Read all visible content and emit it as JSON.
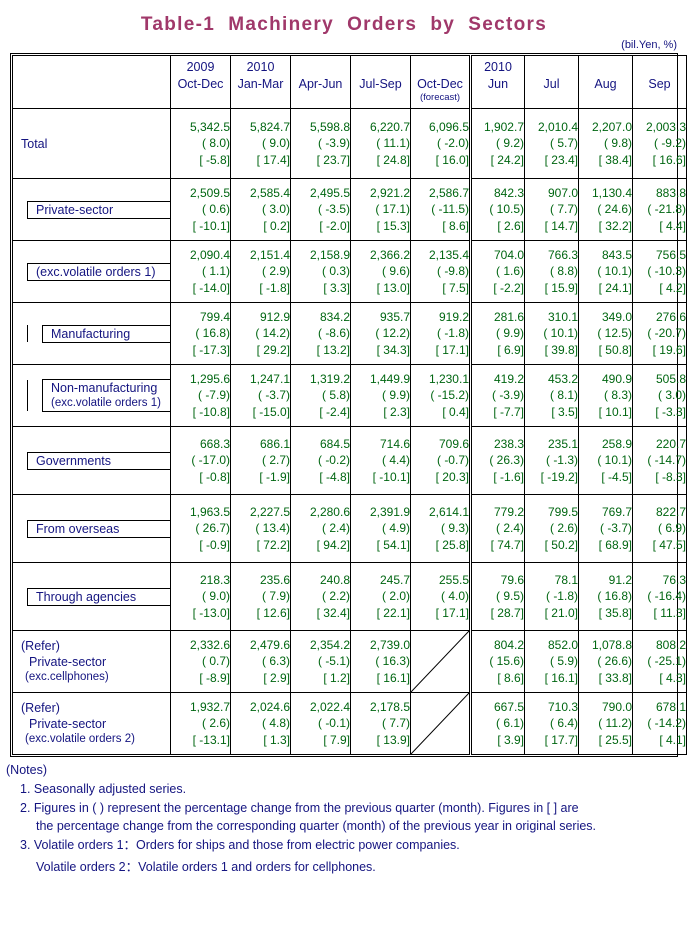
{
  "title": "Table-1  Machinery  Orders  by  Sectors",
  "unit": "(bil.Yen, %)",
  "header": {
    "blank": "",
    "columns": [
      {
        "year": "2009",
        "period": "Oct-Dec",
        "note": ""
      },
      {
        "year": "2010",
        "period": "Jan-Mar",
        "note": ""
      },
      {
        "year": "",
        "period": "Apr-Jun",
        "note": ""
      },
      {
        "year": "",
        "period": "Jul-Sep",
        "note": ""
      },
      {
        "year": "",
        "period": "Oct-Dec",
        "note": "(forecast)"
      },
      {
        "year": "2010",
        "period": "Jun",
        "note": ""
      },
      {
        "year": "",
        "period": "Jul",
        "note": ""
      },
      {
        "year": "",
        "period": "Aug",
        "note": ""
      },
      {
        "year": "",
        "period": "Sep",
        "note": ""
      }
    ]
  },
  "rows": [
    {
      "id": "total",
      "label": "Total",
      "label2": "",
      "label3": "",
      "indent": 0,
      "values": [
        {
          "v1": "5,342.5",
          "v2": "( 8.0)",
          "v3": "[ -5.8]"
        },
        {
          "v1": "5,824.7",
          "v2": "( 9.0)",
          "v3": "[ 17.4]"
        },
        {
          "v1": "5,598.8",
          "v2": "( -3.9)",
          "v3": "[ 23.7]"
        },
        {
          "v1": "6,220.7",
          "v2": "( 11.1)",
          "v3": "[ 24.8]"
        },
        {
          "v1": "6,096.5",
          "v2": "( -2.0)",
          "v3": "[ 16.0]"
        },
        {
          "v1": "1,902.7",
          "v2": "( 9.2)",
          "v3": "[ 24.2]"
        },
        {
          "v1": "2,010.4",
          "v2": "( 5.7)",
          "v3": "[ 23.4]"
        },
        {
          "v1": "2,207.0",
          "v2": "( 9.8)",
          "v3": "[ 38.4]"
        },
        {
          "v1": "2,003.3",
          "v2": "( -9.2)",
          "v3": "[ 16.6]"
        }
      ]
    },
    {
      "id": "private-sector",
      "label": "Private-sector",
      "label2": "",
      "label3": "",
      "indent": 1,
      "values": [
        {
          "v1": "2,509.5",
          "v2": "( 0.6)",
          "v3": "[ -10.1]"
        },
        {
          "v1": "2,585.4",
          "v2": "( 3.0)",
          "v3": "[ 0.2]"
        },
        {
          "v1": "2,495.5",
          "v2": "( -3.5)",
          "v3": "[ -2.0]"
        },
        {
          "v1": "2,921.2",
          "v2": "( 17.1)",
          "v3": "[ 15.3]"
        },
        {
          "v1": "2,586.7",
          "v2": "( -11.5)",
          "v3": "[ 8.6]"
        },
        {
          "v1": "842.3",
          "v2": "( 10.5)",
          "v3": "[ 2.6]"
        },
        {
          "v1": "907.0",
          "v2": "( 7.7)",
          "v3": "[ 14.7]"
        },
        {
          "v1": "1,130.4",
          "v2": "( 24.6)",
          "v3": "[ 32.2]"
        },
        {
          "v1": "883.8",
          "v2": "( -21.8)",
          "v3": "[ 4.4]"
        }
      ]
    },
    {
      "id": "private-sector-exc-volatile",
      "label": "(exc.volatile orders 1)",
      "label2": "",
      "label3": "",
      "indent": 1,
      "values": [
        {
          "v1": "2,090.4",
          "v2": "( 1.1)",
          "v3": "[ -14.0]"
        },
        {
          "v1": "2,151.4",
          "v2": "( 2.9)",
          "v3": "[ -1.8]"
        },
        {
          "v1": "2,158.9",
          "v2": "( 0.3)",
          "v3": "[ 3.3]"
        },
        {
          "v1": "2,366.2",
          "v2": "( 9.6)",
          "v3": "[ 13.0]"
        },
        {
          "v1": "2,135.4",
          "v2": "( -9.8)",
          "v3": "[ 7.5]"
        },
        {
          "v1": "704.0",
          "v2": "( 1.6)",
          "v3": "[ -2.2]"
        },
        {
          "v1": "766.3",
          "v2": "( 8.8)",
          "v3": "[ 15.9]"
        },
        {
          "v1": "843.5",
          "v2": "( 10.1)",
          "v3": "[ 24.1]"
        },
        {
          "v1": "756.5",
          "v2": "( -10.3)",
          "v3": "[ 4.2]"
        }
      ]
    },
    {
      "id": "manufacturing",
      "label": "Manufacturing",
      "label2": "",
      "label3": "",
      "indent": 2,
      "values": [
        {
          "v1": "799.4",
          "v2": "( 16.8)",
          "v3": "[ -17.3]"
        },
        {
          "v1": "912.9",
          "v2": "( 14.2)",
          "v3": "[ 29.2]"
        },
        {
          "v1": "834.2",
          "v2": "( -8.6)",
          "v3": "[ 13.2]"
        },
        {
          "v1": "935.7",
          "v2": "( 12.2)",
          "v3": "[ 34.3]"
        },
        {
          "v1": "919.2",
          "v2": "( -1.8)",
          "v3": "[ 17.1]"
        },
        {
          "v1": "281.6",
          "v2": "( 9.9)",
          "v3": "[ 6.9]"
        },
        {
          "v1": "310.1",
          "v2": "( 10.1)",
          "v3": "[ 39.8]"
        },
        {
          "v1": "349.0",
          "v2": "( 12.5)",
          "v3": "[ 50.8]"
        },
        {
          "v1": "276.6",
          "v2": "( -20.7)",
          "v3": "[ 19.6]"
        }
      ]
    },
    {
      "id": "non-manufacturing",
      "label": "Non-manufacturing",
      "label2": "(exc.volatile orders 1)",
      "label3": "",
      "indent": 2,
      "values": [
        {
          "v1": "1,295.6",
          "v2": "( -7.9)",
          "v3": "[ -10.8]"
        },
        {
          "v1": "1,247.1",
          "v2": "( -3.7)",
          "v3": "[ -15.0]"
        },
        {
          "v1": "1,319.2",
          "v2": "( 5.8)",
          "v3": "[ -2.4]"
        },
        {
          "v1": "1,449.9",
          "v2": "( 9.9)",
          "v3": "[ 2.3]"
        },
        {
          "v1": "1,230.1",
          "v2": "( -15.2)",
          "v3": "[ 0.4]"
        },
        {
          "v1": "419.2",
          "v2": "( -3.9)",
          "v3": "[ -7.7]"
        },
        {
          "v1": "453.2",
          "v2": "( 8.1)",
          "v3": "[ 3.5]"
        },
        {
          "v1": "490.9",
          "v2": "( 8.3)",
          "v3": "[ 10.1]"
        },
        {
          "v1": "505.8",
          "v2": "( 3.0)",
          "v3": "[ -3.3]"
        }
      ]
    },
    {
      "id": "governments",
      "label": "Governments",
      "label2": "",
      "label3": "",
      "indent": 1,
      "values": [
        {
          "v1": "668.3",
          "v2": "( -17.0)",
          "v3": "[ -0.8]"
        },
        {
          "v1": "686.1",
          "v2": "( 2.7)",
          "v3": "[ -1.9]"
        },
        {
          "v1": "684.5",
          "v2": "( -0.2)",
          "v3": "[ -4.8]"
        },
        {
          "v1": "714.6",
          "v2": "( 4.4)",
          "v3": "[ -10.1]"
        },
        {
          "v1": "709.6",
          "v2": "( -0.7)",
          "v3": "[ 20.3]"
        },
        {
          "v1": "238.3",
          "v2": "( 26.3)",
          "v3": "[ -1.6]"
        },
        {
          "v1": "235.1",
          "v2": "( -1.3)",
          "v3": "[ -19.2]"
        },
        {
          "v1": "258.9",
          "v2": "( 10.1)",
          "v3": "[ -4.5]"
        },
        {
          "v1": "220.7",
          "v2": "( -14.7)",
          "v3": "[ -8.3]"
        }
      ]
    },
    {
      "id": "from-overseas",
      "label": "From overseas",
      "label2": "",
      "label3": "",
      "indent": 1,
      "values": [
        {
          "v1": "1,963.5",
          "v2": "( 26.7)",
          "v3": "[ -0.9]"
        },
        {
          "v1": "2,227.5",
          "v2": "( 13.4)",
          "v3": "[ 72.2]"
        },
        {
          "v1": "2,280.6",
          "v2": "( 2.4)",
          "v3": "[ 94.2]"
        },
        {
          "v1": "2,391.9",
          "v2": "( 4.9)",
          "v3": "[ 54.1]"
        },
        {
          "v1": "2,614.1",
          "v2": "( 9.3)",
          "v3": "[ 25.8]"
        },
        {
          "v1": "779.2",
          "v2": "( 2.4)",
          "v3": "[ 74.7]"
        },
        {
          "v1": "799.5",
          "v2": "( 2.6)",
          "v3": "[ 50.2]"
        },
        {
          "v1": "769.7",
          "v2": "( -3.7)",
          "v3": "[ 68.9]"
        },
        {
          "v1": "822.7",
          "v2": "( 6.9)",
          "v3": "[ 47.5]"
        }
      ]
    },
    {
      "id": "through-agencies",
      "label": "Through agencies",
      "label2": "",
      "label3": "",
      "indent": 1,
      "values": [
        {
          "v1": "218.3",
          "v2": "( 9.0)",
          "v3": "[ -13.0]"
        },
        {
          "v1": "235.6",
          "v2": "( 7.9)",
          "v3": "[ 12.6]"
        },
        {
          "v1": "240.8",
          "v2": "( 2.2)",
          "v3": "[ 32.4]"
        },
        {
          "v1": "245.7",
          "v2": "( 2.0)",
          "v3": "[ 22.1]"
        },
        {
          "v1": "255.5",
          "v2": "( 4.0)",
          "v3": "[ 17.1]"
        },
        {
          "v1": "79.6",
          "v2": "( 9.5)",
          "v3": "[ 28.7]"
        },
        {
          "v1": "78.1",
          "v2": "( -1.8)",
          "v3": "[ 21.0]"
        },
        {
          "v1": "91.2",
          "v2": "( 16.8)",
          "v3": "[ 35.8]"
        },
        {
          "v1": "76.3",
          "v2": "( -16.4)",
          "v3": "[ 11.3]"
        }
      ]
    },
    {
      "id": "refer-exc-cellphones",
      "label": "(Refer)",
      "label2": "Private-sector",
      "label3": "(exc.cellphones)",
      "indent": 0,
      "refer": true,
      "values": [
        {
          "v1": "2,332.6",
          "v2": "( 0.7)",
          "v3": "[ -8.9]"
        },
        {
          "v1": "2,479.6",
          "v2": "( 6.3)",
          "v3": "[ 2.9]"
        },
        {
          "v1": "2,354.2",
          "v2": "( -5.1)",
          "v3": "[ 1.2]"
        },
        {
          "v1": "2,739.0",
          "v2": "( 16.3)",
          "v3": "[ 16.1]"
        },
        {
          "slash": true
        },
        {
          "v1": "804.2",
          "v2": "( 15.6)",
          "v3": "[ 8.6]"
        },
        {
          "v1": "852.0",
          "v2": "( 5.9)",
          "v3": "[ 16.1]"
        },
        {
          "v1": "1,078.8",
          "v2": "( 26.6)",
          "v3": "[ 33.8]"
        },
        {
          "v1": "808.2",
          "v2": "( -25.1)",
          "v3": "[ 4.3]"
        }
      ]
    },
    {
      "id": "refer-exc-volatile-2",
      "label": "(Refer)",
      "label2": "Private-sector",
      "label3": "(exc.volatile orders 2)",
      "indent": 0,
      "refer": true,
      "values": [
        {
          "v1": "1,932.7",
          "v2": "( 2.6)",
          "v3": "[ -13.1]"
        },
        {
          "v1": "2,024.6",
          "v2": "( 4.8)",
          "v3": "[ 1.3]"
        },
        {
          "v1": "2,022.4",
          "v2": "( -0.1)",
          "v3": "[ 7.9]"
        },
        {
          "v1": "2,178.5",
          "v2": "( 7.7)",
          "v3": "[ 13.9]"
        },
        {
          "slash": true
        },
        {
          "v1": "667.5",
          "v2": "( 6.1)",
          "v3": "[ 3.9]"
        },
        {
          "v1": "710.3",
          "v2": "( 6.4)",
          "v3": "[ 17.7]"
        },
        {
          "v1": "790.0",
          "v2": "( 11.2)",
          "v3": "[ 25.5]"
        },
        {
          "v1": "678.1",
          "v2": "( -14.2)",
          "v3": "[ 4.1]"
        }
      ]
    }
  ],
  "notes": {
    "heading": "(Notes)",
    "items": [
      "1. Seasonally adjusted series.",
      "2. Figures in ( ) represent the percentage change from the previous quarter (month). Figures in [ ] are",
      "the percentage change from the corresponding quarter (month) of the previous year in original series.",
      "3. Volatile orders 1：Orders for ships and those from electric power companies.",
      "Volatile orders 2：Volatile orders 1 and orders for cellphones."
    ]
  },
  "colors": {
    "title": "#a0386a",
    "label": "#141480",
    "value": "#006611"
  }
}
